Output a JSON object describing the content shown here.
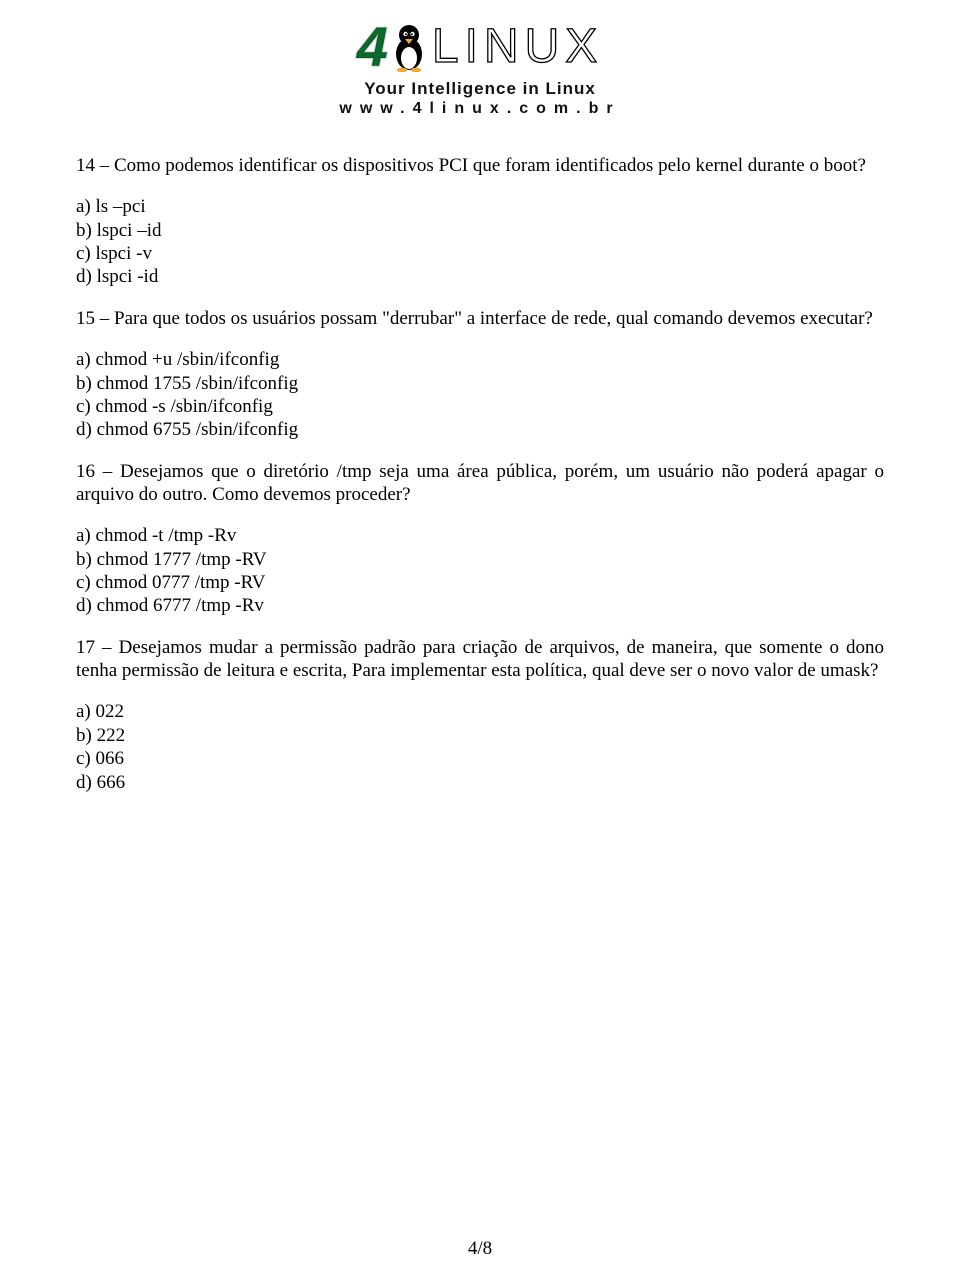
{
  "header": {
    "logo_4": "4",
    "logo_text": "LINUX",
    "tagline": "Your Intelligence in Linux",
    "url": "www.4linux.com.br"
  },
  "q14": {
    "text": "14 – Como podemos identificar os dispositivos PCI que foram identificados pelo kernel durante o boot?",
    "a": "a) ls –pci",
    "b": "b) lspci –id",
    "c": "c)  lspci -v",
    "d": "d)  lspci -id"
  },
  "q15": {
    "text": "15 – Para que todos os usuários possam \"derrubar\" a interface de rede, qual comando devemos executar?",
    "a": "a) chmod +u /sbin/ifconfig",
    "b": "b) chmod 1755 /sbin/ifconfig",
    "c": "c)  chmod -s /sbin/ifconfig",
    "d": "d)  chmod 6755 /sbin/ifconfig"
  },
  "q16": {
    "text": "16 – Desejamos que o diretório /tmp seja uma área pública, porém, um usuário não poderá apagar o arquivo do outro. Como devemos proceder?",
    "a": "a) chmod -t /tmp -Rv",
    "b": "b) chmod 1777 /tmp -RV",
    "c": "c)  chmod 0777 /tmp -RV",
    "d": "d)  chmod 6777 /tmp -Rv"
  },
  "q17": {
    "text": "17 – Desejamos mudar a permissão padrão para criação de arquivos, de maneira, que somente o dono tenha permissão de leitura e escrita, Para implementar esta política, qual deve ser o novo valor de umask?",
    "a": "a) 022",
    "b": "b) 222",
    "c": "c)  066",
    "d": "d)  666"
  },
  "page_number": "4/8"
}
